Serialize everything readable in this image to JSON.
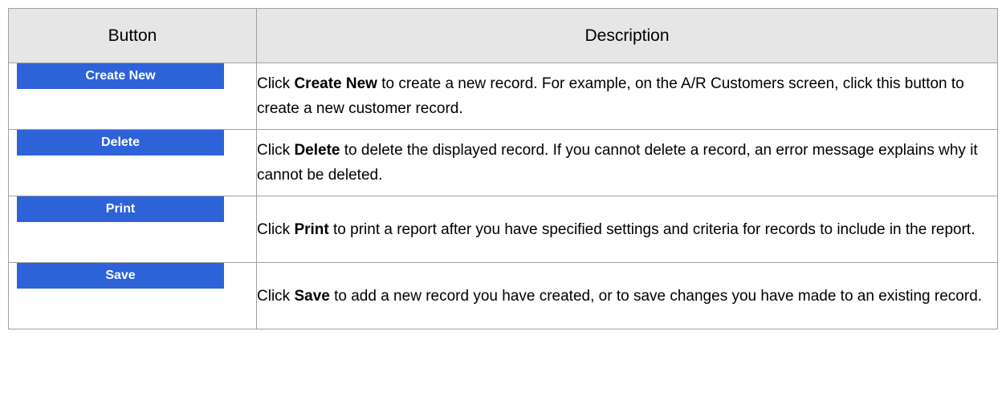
{
  "table": {
    "headers": {
      "button": "Button",
      "description": "Description"
    },
    "rows": [
      {
        "button_label": "Create New",
        "desc_prefix": "Click ",
        "desc_keyword": "Create New",
        "desc_suffix": " to create a new record. For example, on the A/R Customers screen, click this button to create a new customer record."
      },
      {
        "button_label": "Delete",
        "desc_prefix": "Click ",
        "desc_keyword": "Delete",
        "desc_suffix": " to delete the displayed record. If you cannot delete a record, an error message explains why it cannot be deleted."
      },
      {
        "button_label": "Print",
        "desc_prefix": "Click ",
        "desc_keyword": "Print",
        "desc_suffix": " to print a report after you have specified settings and criteria for records to include in the report."
      },
      {
        "button_label": "Save",
        "desc_prefix": "Click ",
        "desc_keyword": "Save",
        "desc_suffix": " to add a new record you have created, or to save changes you have made to an existing record."
      }
    ]
  },
  "colors": {
    "button_bg": "#2e62d9",
    "header_bg": "#e6e6e6",
    "border": "#a0a0a0"
  }
}
